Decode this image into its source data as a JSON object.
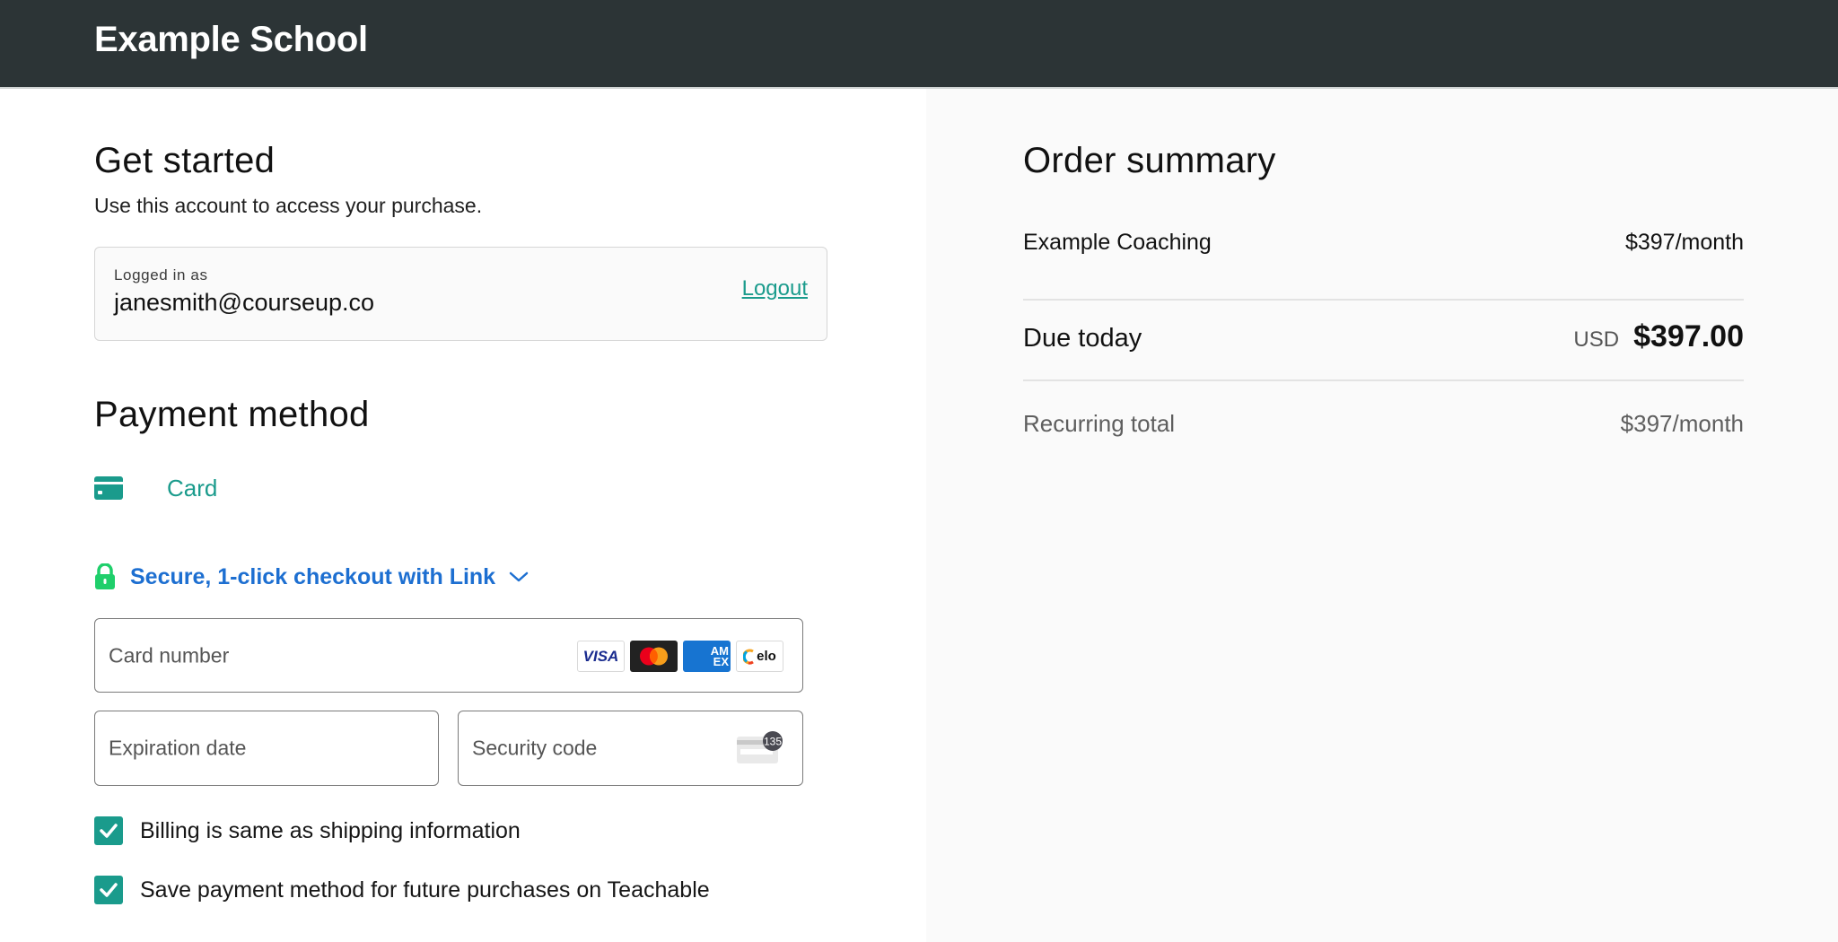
{
  "header": {
    "brand": "Example School"
  },
  "get_started": {
    "title": "Get started",
    "subtitle": "Use this account to access your purchase.",
    "logged_in_label": "Logged in as",
    "email": "janesmith@courseup.co",
    "logout_label": "Logout"
  },
  "payment": {
    "title": "Payment method",
    "method_label": "Card",
    "link_text": "Secure, 1-click checkout with Link",
    "card_number_placeholder": "Card number",
    "expiration_placeholder": "Expiration date",
    "security_code_placeholder": "Security code",
    "cvc_hint": "135",
    "card_brands": [
      {
        "name": "VISA",
        "icon": "visa-logo"
      },
      {
        "name": "Mastercard",
        "icon": "mastercard-logo"
      },
      {
        "name": "AMEX",
        "icon": "amex-logo"
      },
      {
        "name": "elo",
        "icon": "elo-logo"
      }
    ],
    "checkboxes": [
      {
        "label": "Billing is same as shipping information",
        "checked": true
      },
      {
        "label": "Save payment method for future purchases on Teachable",
        "checked": true
      }
    ]
  },
  "order_summary": {
    "title": "Order summary",
    "item_name": "Example Coaching",
    "item_price": "$397/month",
    "due_today_label": "Due today",
    "currency": "USD",
    "due_today_amount": "$397.00",
    "recurring_label": "Recurring total",
    "recurring_amount": "$397/month"
  },
  "colors": {
    "header_bg": "#2c3436",
    "accent_teal": "#1a9b8c",
    "link_blue": "#1d6fd1",
    "lock_green": "#1fcf6b"
  }
}
